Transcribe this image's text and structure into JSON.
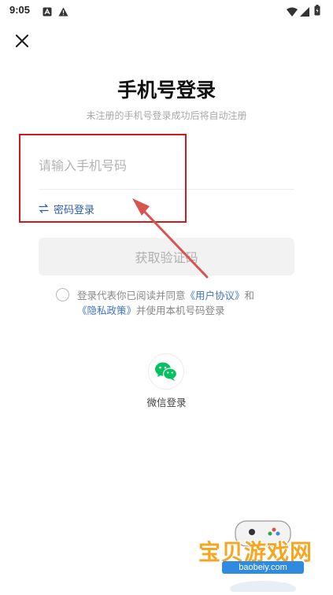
{
  "status_bar": {
    "time": "9:05",
    "left_icons": [
      "notification-a-icon",
      "warning-icon"
    ],
    "right_icons": [
      "wifi-icon",
      "signal-icon",
      "battery-icon"
    ]
  },
  "header": {
    "close_icon": "close-icon"
  },
  "login": {
    "title": "手机号登录",
    "subtitle": "未注册的手机号登录成功后将自动注册",
    "phone_placeholder": "请输入手机号码",
    "phone_value": "",
    "password_login_label": "密码登录",
    "get_code_label": "获取验证码",
    "agreement_prefix": "登录代表你已阅读并同意",
    "user_agreement_link": "《用户协议》",
    "agreement_and": "和",
    "privacy_link": "《隐私政策》",
    "agreement_suffix": "并使用本机号码登录",
    "agreement_checked": false
  },
  "third_party": {
    "wechat_label": "微信登录",
    "wechat_icon": "wechat-icon"
  },
  "annotation": {
    "highlight_color": "#d21a1a",
    "arrow_color": "#d9534f"
  },
  "watermark": {
    "text": "宝贝游戏网",
    "url": "baobeiy.com"
  },
  "colors": {
    "link": "#3e73c9",
    "disabled_button": "#f2f2f2",
    "wechat_green": "#07c160"
  }
}
